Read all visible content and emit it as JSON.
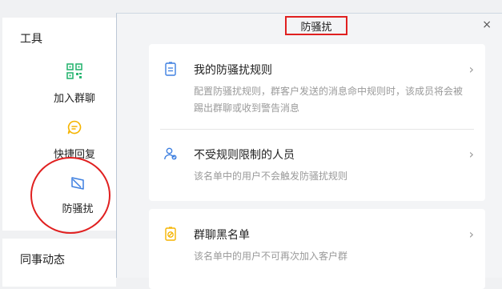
{
  "tools": {
    "title": "工具",
    "items": [
      {
        "label": "加入群聊",
        "icon": "qr-code-icon"
      },
      {
        "label": "快捷回复",
        "icon": "chat-bubble-icon"
      },
      {
        "label": "防骚扰",
        "icon": "shield-flag-icon"
      }
    ]
  },
  "colleague": {
    "title": "同事动态"
  },
  "dialog": {
    "title": "防骚扰",
    "close": "×",
    "options": [
      {
        "title": "我的防骚扰规则",
        "desc": "配置防骚扰规则，群客户发送的消息命中规则时，该成员将会被踢出群聊或收到警告消息",
        "icon": "clipboard-icon"
      },
      {
        "title": "不受规则限制的人员",
        "desc": "该名单中的用户不会触发防骚扰规则",
        "icon": "user-check-icon"
      },
      {
        "title": "群聊黑名单",
        "desc": "该名单中的用户不可再次加入客户群",
        "icon": "clipboard-block-icon"
      }
    ]
  },
  "colors": {
    "accent_green": "#2bb673",
    "accent_yellow": "#f5b400",
    "accent_blue": "#3d7fe0",
    "highlight_red": "#e02020"
  }
}
